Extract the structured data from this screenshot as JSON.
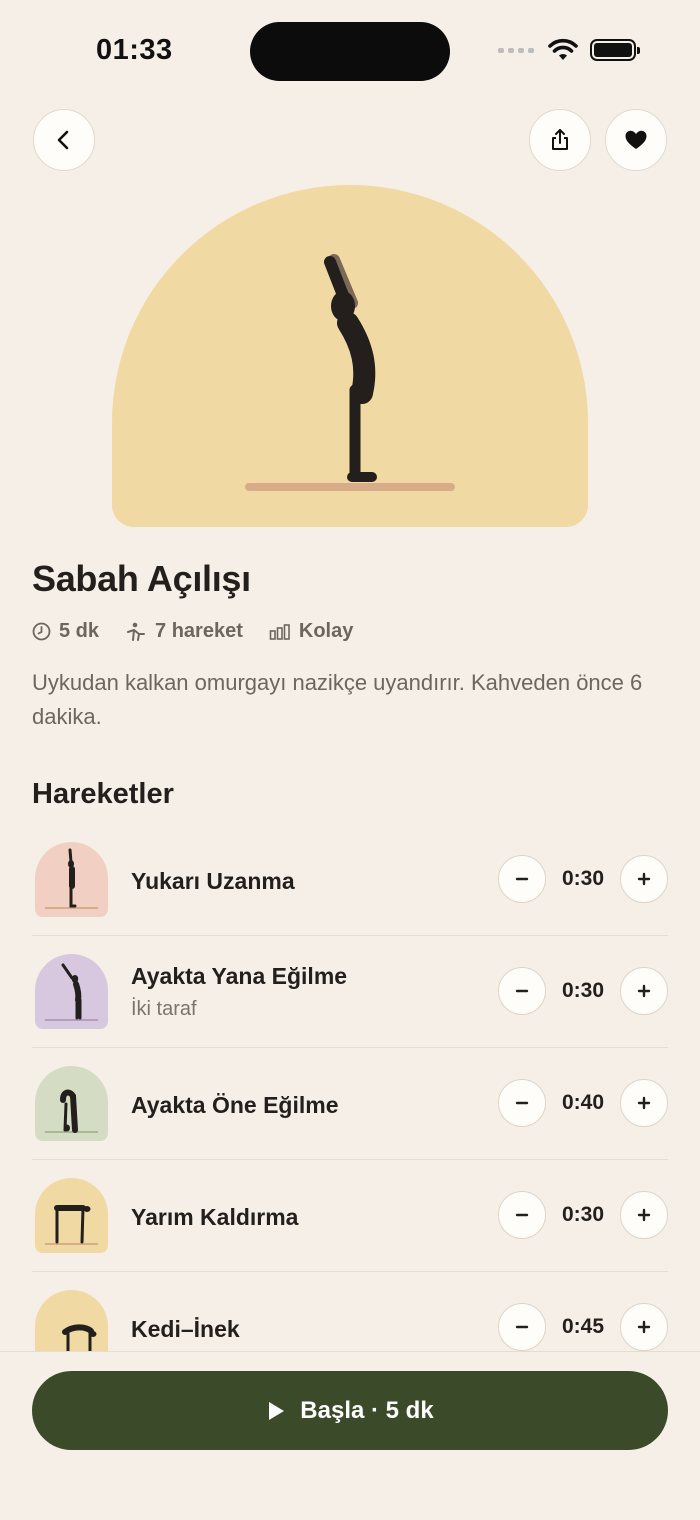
{
  "status_bar": {
    "time": "01:33"
  },
  "header": {
    "back_icon": "chevron-left-icon",
    "share_icon": "share-icon",
    "favorite_icon": "heart-icon"
  },
  "routine": {
    "title": "Sabah Açılışı",
    "meta": {
      "duration": "5 dk",
      "moves": "7 hareket",
      "level": "Kolay"
    },
    "description": "Uykudan kalkan omurgayı nazikçe uyandırır. Kahveden önce 6 dakika."
  },
  "section": {
    "title": "Hareketler"
  },
  "moves": [
    {
      "name": "Yukarı Uzanma",
      "subtitle": "",
      "duration": "0:30",
      "color": "#f2cfc3"
    },
    {
      "name": "Ayakta Yana Eğilme",
      "subtitle": "İki taraf",
      "duration": "0:30",
      "color": "#d8c8df"
    },
    {
      "name": "Ayakta Öne Eğilme",
      "subtitle": "",
      "duration": "0:40",
      "color": "#d4dcc3"
    },
    {
      "name": "Yarım Kaldırma",
      "subtitle": "",
      "duration": "0:30",
      "color": "#f0d9a3"
    },
    {
      "name": "Kedi–İnek",
      "subtitle": "",
      "duration": "0:45",
      "color": "#f0d9a3"
    }
  ],
  "start_button": {
    "label": "Başla · 5 dk"
  },
  "colors": {
    "background": "#f5efe8",
    "hero": "#f0d9a3",
    "primary": "#3b4a29",
    "text": "#221f1c",
    "muted": "#6d665e"
  }
}
